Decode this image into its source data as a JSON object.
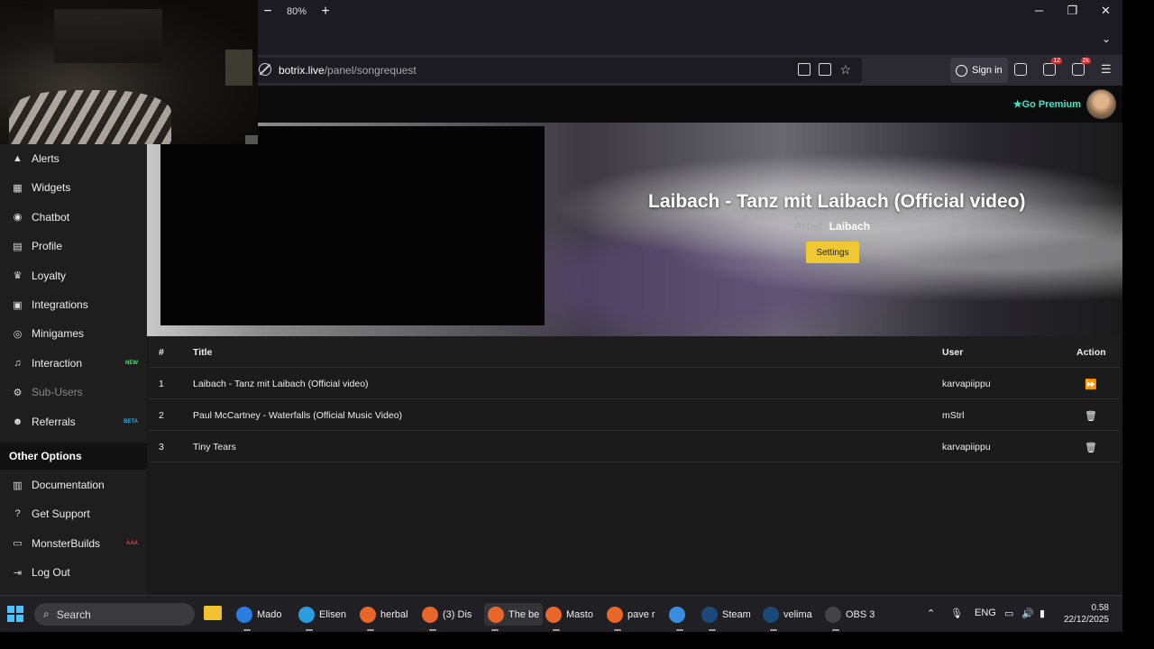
{
  "browser": {
    "zoom_level": "80%",
    "zoom_minus": "−",
    "zoom_plus": "+",
    "window_minimize": "─",
    "window_restore": "❐",
    "window_close": "✕",
    "tabs_dropdown": "⌄",
    "url_host": "botrix.live",
    "url_path": "/panel/songrequest",
    "sign_in": "Sign in",
    "badge_ext1": "12",
    "badge_ext2": "2k"
  },
  "topnav": {
    "premium": "Go Premium",
    "premium_icon": "★"
  },
  "sidebar": {
    "items": [
      {
        "label": "Alerts",
        "icon": "warning-icon",
        "glyph": "▲"
      },
      {
        "label": "Widgets",
        "icon": "grid-icon",
        "glyph": "▦"
      },
      {
        "label": "Chatbot",
        "icon": "robot-icon",
        "glyph": "◉"
      },
      {
        "label": "Profile",
        "icon": "id-card-icon",
        "glyph": "▤"
      },
      {
        "label": "Loyalty",
        "icon": "trophy-icon",
        "glyph": "♛"
      },
      {
        "label": "Integrations",
        "icon": "plug-icon",
        "glyph": "▣"
      },
      {
        "label": "Minigames",
        "icon": "gamepad-icon",
        "glyph": "◎"
      },
      {
        "label": "Interaction",
        "icon": "music-icon",
        "glyph": "♫",
        "tag": "NEW",
        "tag_color": "#3ee66a"
      },
      {
        "label": "Sub-Users",
        "icon": "users-icon",
        "glyph": "⚙",
        "disabled": true
      },
      {
        "label": "Referrals",
        "icon": "user-group-icon",
        "glyph": "☻",
        "tag": "BETA",
        "tag_color": "#3ea8e6"
      }
    ],
    "section_title": "Other Options",
    "other_items": [
      {
        "label": "Documentation",
        "icon": "book-icon",
        "glyph": "▥"
      },
      {
        "label": "Get Support",
        "icon": "question-icon",
        "glyph": "?"
      },
      {
        "label": "MonsterBuilds",
        "icon": "laptop-icon",
        "glyph": "▭",
        "tag": "AAA",
        "tag_color": "#e63e3e"
      },
      {
        "label": "Log Out",
        "icon": "logout-icon",
        "glyph": "⇥"
      }
    ]
  },
  "now_playing": {
    "title": "Laibach - Tanz mit Laibach (Official video)",
    "artist_label": "Artist:",
    "artist": "Laibach",
    "settings_button": "Settings"
  },
  "queue": {
    "headers": {
      "num": "#",
      "title": "Title",
      "user": "User",
      "action": "Action"
    },
    "rows": [
      {
        "num": "1",
        "title": "Laibach - Tanz mit Laibach (Official video)",
        "user": "karvapiippu",
        "action": "⏩",
        "action_icon": "skip-icon"
      },
      {
        "num": "2",
        "title": "Paul McCartney - Waterfalls (Official Music Video)",
        "user": "mStrl",
        "action": "🗑",
        "action_icon": "trash-icon"
      },
      {
        "num": "3",
        "title": "Tiny Tears",
        "user": "karvapiippu",
        "action": "🗑",
        "action_icon": "trash-icon"
      }
    ]
  },
  "taskbar": {
    "search": "Search",
    "apps": [
      {
        "label": "Mado",
        "color": "#2a7de1"
      },
      {
        "label": "Elisen",
        "color": "#2a9de1"
      },
      {
        "label": "herbal",
        "color": "#e8662a"
      },
      {
        "label": "(3) Dis",
        "color": "#e8662a"
      },
      {
        "label": "The be",
        "color": "#e8662a"
      },
      {
        "label": "Masto",
        "color": "#e8662a"
      },
      {
        "label": "pave r",
        "color": "#e8662a"
      },
      {
        "label": "",
        "color": "#3a8de1"
      },
      {
        "label": "Steam",
        "color": "#1b4a7a"
      },
      {
        "label": "velima",
        "color": "#1b4a7a"
      },
      {
        "label": "OBS 3",
        "color": "#444"
      }
    ],
    "lang": "ENG",
    "time": "0.58",
    "date": "22/12/2025"
  }
}
